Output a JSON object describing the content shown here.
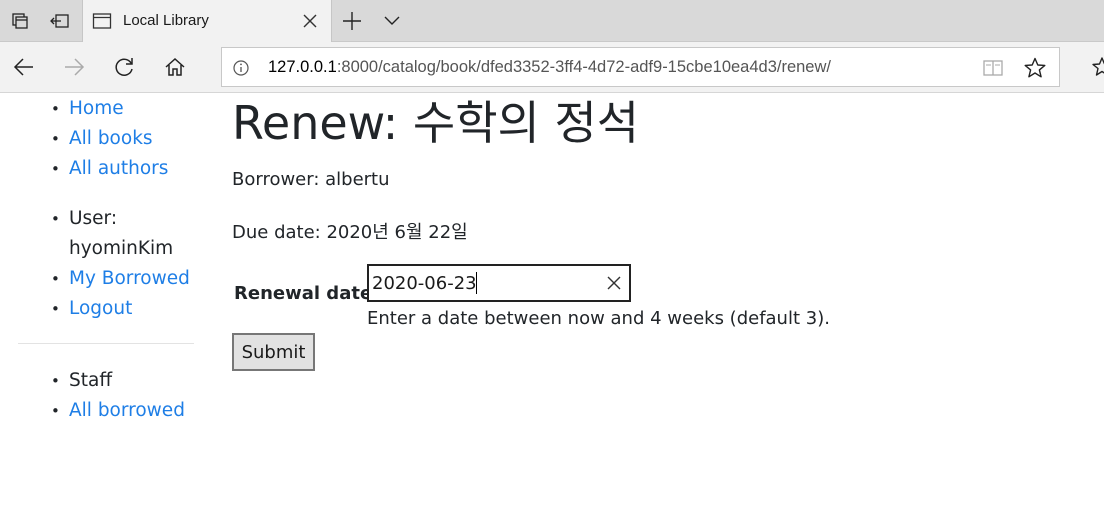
{
  "browser": {
    "tab_title": "Local Library",
    "address_host": "127.0.0.1",
    "address_path": ":8000/catalog/book/dfed3352-3ff4-4d72-adf9-15cbe10ea4d3/renew/",
    "icons": [
      "tab-actions-icon",
      "set-tabs-aside-icon",
      "page-icon",
      "close-icon",
      "new-tab-icon",
      "chevron-down-icon",
      "back-arrow-icon",
      "forward-arrow-icon",
      "refresh-icon",
      "home-icon",
      "info-icon",
      "reading-view-icon",
      "star-icon",
      "favorites-icon"
    ]
  },
  "sidebar": {
    "nav": [
      {
        "label": "Home"
      },
      {
        "label": "All books"
      },
      {
        "label": "All authors"
      }
    ],
    "user_label": "User:",
    "username": "hyominKim",
    "my_borrowed": "My Borrowed",
    "logout": "Logout",
    "staff_label": "Staff",
    "all_borrowed": "All borrowed"
  },
  "main": {
    "title": "Renew: 수학의 정석",
    "borrower": "Borrower: albertu",
    "due_date": "Due date: 2020년 6월 22일",
    "renewal_label": "Renewal date:",
    "renewal_value": "2020-06-23",
    "help_text": "Enter a date between now and 4 weeks (default 3).",
    "submit_label": "Submit"
  },
  "colors": {
    "link": "#1e7ee6",
    "text": "#212529",
    "chrome": "#f2f2f2"
  }
}
